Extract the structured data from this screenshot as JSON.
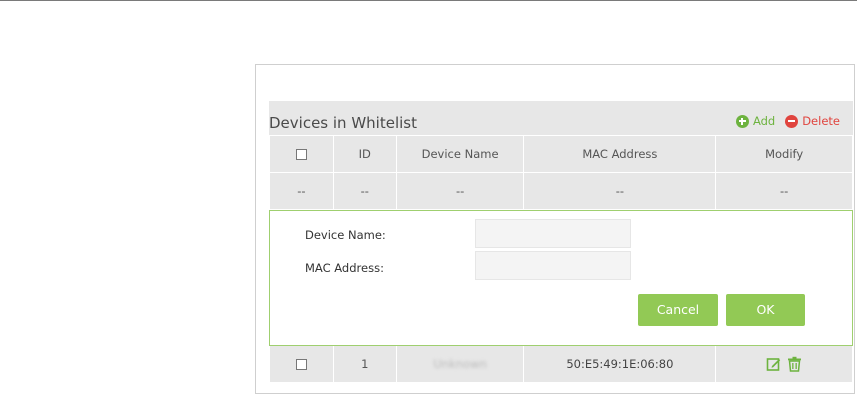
{
  "section": {
    "title": "Devices in Whitelist"
  },
  "toolbar": {
    "add_label": "Add",
    "delete_label": "Delete"
  },
  "table": {
    "columns": [
      "ID",
      "Device Name",
      "MAC Address",
      "Modify"
    ],
    "placeholder_row": [
      "--",
      "--",
      "--",
      "--",
      "--"
    ],
    "rows": [
      {
        "id": "1",
        "device_name": "Unknown",
        "mac": "50:E5:49:1E:06:80"
      }
    ]
  },
  "form": {
    "device_name_label": "Device Name:",
    "device_name_value": "",
    "mac_label": "MAC Address:",
    "mac_value": "",
    "cancel_label": "Cancel",
    "ok_label": "OK"
  },
  "colors": {
    "accent_green": "#92c955",
    "add_green": "#6db33f",
    "delete_red": "#e0443e"
  }
}
